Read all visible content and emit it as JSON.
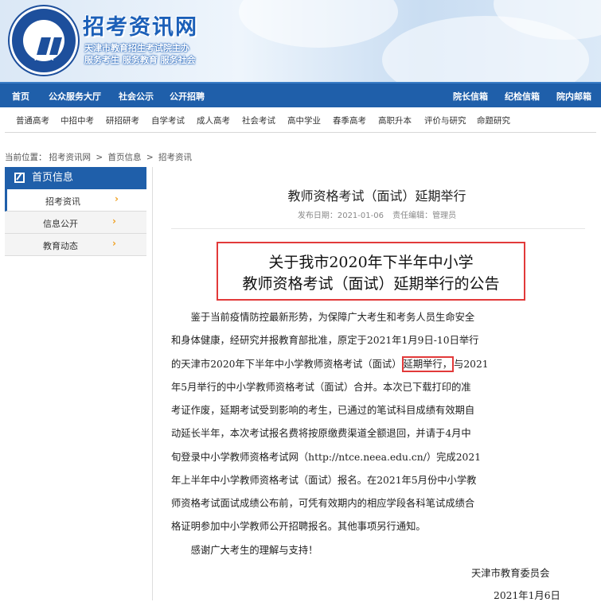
{
  "header": {
    "logo_text": "TAEA",
    "site_title": "招考资讯网",
    "subtitle_1": "天津市教育招生考试院主办",
    "subtitle_2": "服务考生 服务教育 服务社会"
  },
  "nav": {
    "items": [
      "首页",
      "公众服务大厅",
      "社会公示",
      "公开招聘"
    ],
    "right_items": [
      "院长信箱",
      "纪检信箱",
      "院内邮箱"
    ]
  },
  "subnav": {
    "items": [
      "普通高考",
      "中招中考",
      "研招研考",
      "自学考试",
      "成人高考",
      "社会考试",
      "高中学业",
      "春季高考",
      "高职升本",
      "评价与研究",
      "命题研究"
    ]
  },
  "breadcrumb": {
    "prefix": "当前位置：",
    "items": [
      "招考资讯网",
      ">",
      "首页信息",
      ">",
      "招考资讯"
    ]
  },
  "sidebar": {
    "heading": "首页信息",
    "items": [
      {
        "label": "招考资讯",
        "arrow": "›"
      },
      {
        "label": "信息公开",
        "arrow": "›"
      },
      {
        "label": "教育动态",
        "arrow": "›"
      }
    ]
  },
  "article": {
    "title": "教师资格考试（面试）延期举行",
    "publish_date": "发布日期：2021-01-06",
    "editor": "责任编辑：管理员",
    "heading_line1": "关于我市2020年下半年中小学",
    "heading_line2": "教师资格考试（面试）延期举行的公告",
    "lines": [
      "　　鉴于当前疫情防控最新形势，为保障广大考生和考务人员生命安全",
      "和身体健康，经研究并报教育部批准，原定于2021年1月9日-10日举行",
      "的天津市2020年下半年中小学教师资格考试（面试）",
      "年5月举行的中小学教师资格考试（面试）合并。本次已下载打印的准",
      "考证作废，延期考试受到影响的考生，已通过的笔试科目成绩有效期自",
      "动延长半年，本次考试报名费将按原缴费渠道全额退回，并请于4月中",
      "旬登录中小学教师资格考试网（http://ntce.neea.edu.cn/）完成2021",
      "年上半年中小学教师资格考试（面试）报名。在2021年5月份中小学教",
      "师资格考试面试成绩公布前，可凭有效期内的相应学段各科笔试成绩合",
      "格证明参加中小学教师公开招聘报名。其他事项另行通知。",
      "　　感谢广大考生的理解与支持！"
    ],
    "highlight": "延期举行，",
    "line3_tail": "与2021",
    "signature": "天津市教育委员会",
    "date": "2021年1月6日"
  }
}
